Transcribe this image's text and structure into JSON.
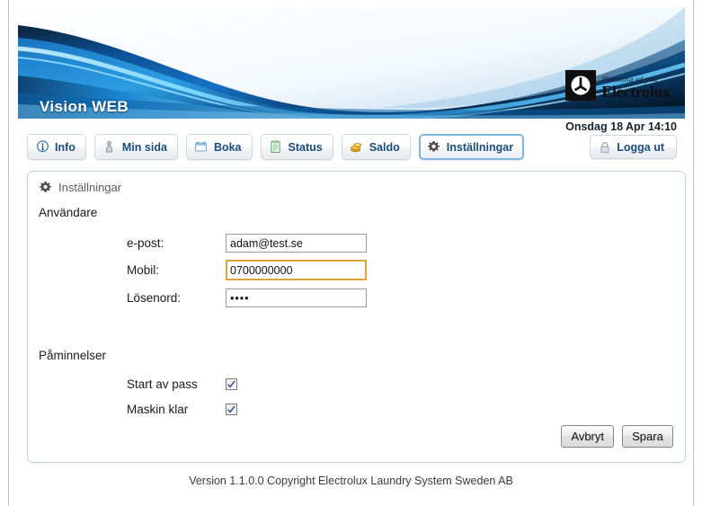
{
  "app": {
    "banner_title": "Vision WEB",
    "logo_tagline": "Thinking of you",
    "logo_word": "Electrolux",
    "datetime": "Onsdag 18 Apr 14:10"
  },
  "nav": {
    "items": [
      {
        "label": "Info",
        "icon": "info-circle-icon",
        "active": false
      },
      {
        "label": "Min sida",
        "icon": "person-icon",
        "active": false
      },
      {
        "label": "Boka",
        "icon": "calendar-icon",
        "active": false
      },
      {
        "label": "Status",
        "icon": "clipboard-icon",
        "active": false
      },
      {
        "label": "Saldo",
        "icon": "coins-icon",
        "active": false
      },
      {
        "label": "Inställningar",
        "icon": "gear-icon",
        "active": true
      }
    ],
    "logout_label": "Logga ut",
    "logout_icon": "padlock-icon"
  },
  "panel": {
    "heading": "Inställningar",
    "heading_icon": "gear-icon",
    "sections": {
      "user": "Användare",
      "reminders": "Påminnelser"
    },
    "fields": {
      "email_label": "e-post:",
      "email_value": "adam@test.se",
      "email_placeholder": "",
      "mobile_label": "Mobil:",
      "mobile_value": "0700000000",
      "mobile_placeholder": "",
      "password_label": "Lösenord:",
      "password_value": "••••",
      "password_placeholder": ""
    },
    "checkboxes": [
      {
        "label": "Start av pass",
        "checked": true
      },
      {
        "label": "Maskin klar",
        "checked": true
      }
    ],
    "actions": {
      "cancel_label": "Avbryt",
      "save_label": "Spara"
    }
  },
  "footer": {
    "text": "Version 1.1.0.0 Copyright Electrolux Laundry System Sweden AB"
  },
  "colors": {
    "accent_blue": "#1c4d7c",
    "panel_border": "#bcd3e4",
    "focus_orange": "#e0a33a",
    "banner_deep": "#0a4d8c"
  }
}
